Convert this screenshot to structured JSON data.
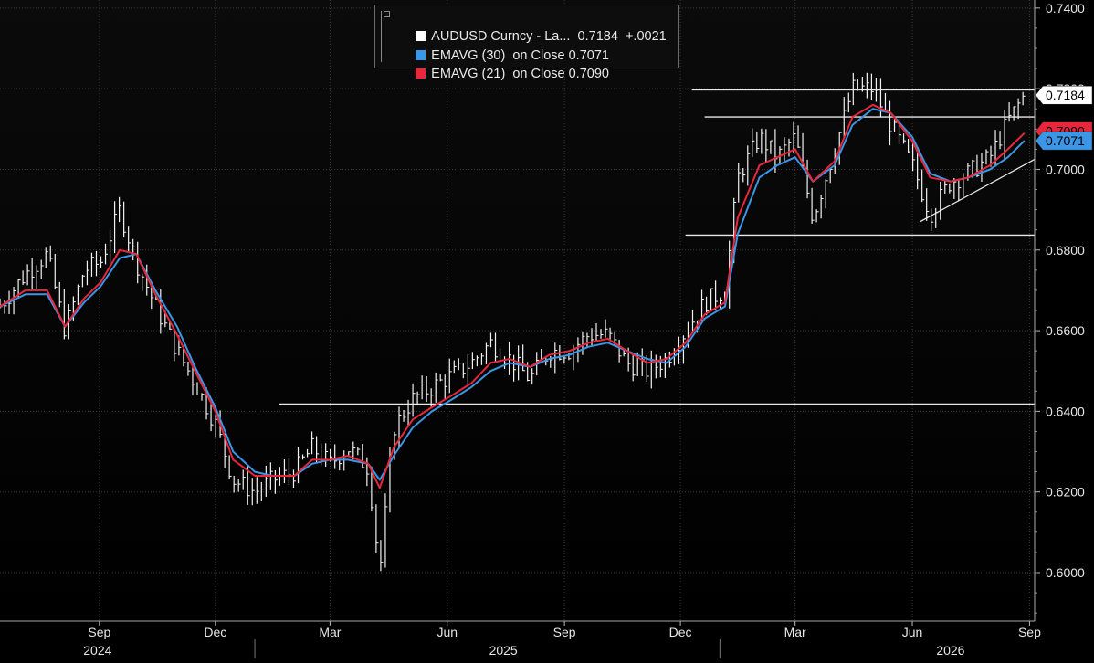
{
  "legend": {
    "rows": [
      {
        "name": "AUDUSD Curncy - La...",
        "value": "0.7184",
        "change": "+.0021",
        "color": "#ffffff"
      },
      {
        "name": "EMAVG (30)",
        "on": "on Close",
        "value": "0.7071",
        "color": "#3c96e6"
      },
      {
        "name": "EMAVG (21)",
        "on": "on Close",
        "value": "0.7090",
        "color": "#e8273a"
      }
    ]
  },
  "axis": {
    "y_ticks": [
      "0.7400",
      "0.7200",
      "0.7000",
      "0.6800",
      "0.6600",
      "0.6400",
      "0.6200",
      "0.6000"
    ],
    "x_months": [
      "Sep",
      "Dec",
      "Mar",
      "Jun",
      "Sep",
      "Dec",
      "Mar",
      "Jun",
      "Sep"
    ],
    "x_years": [
      "2024",
      "2025",
      "2026"
    ]
  },
  "price_tags": {
    "last": {
      "label": "0.7184",
      "value": 0.7184,
      "color": "#ffffff",
      "text_color": "#000000"
    },
    "ema30": {
      "label": "0.7071",
      "value": 0.7071,
      "color": "#3c96e6",
      "text_color": "#000000"
    },
    "ema21": {
      "label": "0.7090",
      "value": 0.709,
      "color": "#e8273a",
      "text_color": "#000000"
    }
  },
  "colors": {
    "background": "#000000",
    "price": "#ffffff",
    "ema30": "#3c96e6",
    "ema21": "#e8273a",
    "grid": "#4a4a4a"
  },
  "chart_data": {
    "type": "line",
    "title": "",
    "xlabel": "",
    "ylabel": "",
    "ylim": [
      0.588,
      0.742
    ],
    "grid": true,
    "legend_placement": "top-center",
    "y_axis_side": "right",
    "x_range": [
      "2024-06-15",
      "2026-09-05"
    ],
    "series": [
      {
        "name": "AUDUSD Curncy - La...",
        "style": "high-low bars",
        "x": [
          "2024-06-15",
          "2024-07-05",
          "2024-07-22",
          "2024-08-05",
          "2024-08-20",
          "2024-09-02",
          "2024-09-17",
          "2024-09-30",
          "2024-10-15",
          "2024-11-01",
          "2024-11-15",
          "2024-12-01",
          "2024-12-15",
          "2025-01-01",
          "2025-01-15",
          "2025-02-01",
          "2025-02-15",
          "2025-03-01",
          "2025-03-15",
          "2025-03-31",
          "2025-04-09",
          "2025-04-20",
          "2025-05-05",
          "2025-05-20",
          "2025-06-05",
          "2025-06-20",
          "2025-07-05",
          "2025-07-20",
          "2025-08-05",
          "2025-08-20",
          "2025-09-05",
          "2025-09-20",
          "2025-10-05",
          "2025-10-20",
          "2025-11-05",
          "2025-11-20",
          "2025-12-05",
          "2025-12-20",
          "2026-01-05",
          "2026-01-15",
          "2026-02-01",
          "2026-02-15",
          "2026-03-01",
          "2026-03-15",
          "2026-04-01",
          "2026-04-15",
          "2026-05-01",
          "2026-05-15",
          "2026-06-01",
          "2026-06-15",
          "2026-07-01",
          "2026-07-15",
          "2026-08-01",
          "2026-08-15",
          "2026-08-28"
        ],
        "values": [
          0.666,
          0.674,
          0.679,
          0.66,
          0.675,
          0.677,
          0.69,
          0.677,
          0.666,
          0.655,
          0.647,
          0.637,
          0.623,
          0.62,
          0.623,
          0.625,
          0.631,
          0.627,
          0.631,
          0.626,
          0.6,
          0.636,
          0.643,
          0.646,
          0.649,
          0.652,
          0.657,
          0.653,
          0.648,
          0.655,
          0.655,
          0.659,
          0.659,
          0.652,
          0.65,
          0.653,
          0.66,
          0.667,
          0.67,
          0.698,
          0.708,
          0.703,
          0.708,
          0.688,
          0.705,
          0.72,
          0.72,
          0.711,
          0.701,
          0.689,
          0.697,
          0.699,
          0.703,
          0.712,
          0.7184
        ]
      },
      {
        "name": "EMAVG (30)",
        "x": [
          "2024-06-15",
          "2024-07-05",
          "2024-07-22",
          "2024-08-05",
          "2024-08-20",
          "2024-09-02",
          "2024-09-17",
          "2024-09-30",
          "2024-10-15",
          "2024-11-01",
          "2024-11-15",
          "2024-12-01",
          "2024-12-15",
          "2025-01-01",
          "2025-01-15",
          "2025-02-01",
          "2025-02-15",
          "2025-03-01",
          "2025-03-15",
          "2025-03-31",
          "2025-04-09",
          "2025-04-20",
          "2025-05-05",
          "2025-05-20",
          "2025-06-05",
          "2025-06-20",
          "2025-07-05",
          "2025-07-20",
          "2025-08-05",
          "2025-08-20",
          "2025-09-05",
          "2025-09-20",
          "2025-10-05",
          "2025-10-20",
          "2025-11-05",
          "2025-11-20",
          "2025-12-05",
          "2025-12-20",
          "2026-01-05",
          "2026-01-15",
          "2026-02-01",
          "2026-02-15",
          "2026-03-01",
          "2026-03-15",
          "2026-04-01",
          "2026-04-15",
          "2026-05-01",
          "2026-05-15",
          "2026-06-01",
          "2026-06-15",
          "2026-07-01",
          "2026-07-15",
          "2026-08-01",
          "2026-08-15",
          "2026-08-28"
        ],
        "values": [
          0.666,
          0.669,
          0.669,
          0.661,
          0.667,
          0.671,
          0.678,
          0.679,
          0.67,
          0.661,
          0.651,
          0.641,
          0.63,
          0.625,
          0.624,
          0.624,
          0.627,
          0.628,
          0.628,
          0.627,
          0.623,
          0.629,
          0.636,
          0.64,
          0.643,
          0.646,
          0.65,
          0.652,
          0.651,
          0.653,
          0.654,
          0.656,
          0.657,
          0.655,
          0.653,
          0.652,
          0.656,
          0.663,
          0.666,
          0.684,
          0.698,
          0.701,
          0.703,
          0.697,
          0.701,
          0.711,
          0.715,
          0.714,
          0.708,
          0.699,
          0.697,
          0.698,
          0.7,
          0.703,
          0.7071
        ]
      },
      {
        "name": "EMAVG (21)",
        "x": [
          "2024-06-15",
          "2024-07-05",
          "2024-07-22",
          "2024-08-05",
          "2024-08-20",
          "2024-09-02",
          "2024-09-17",
          "2024-09-30",
          "2024-10-15",
          "2024-11-01",
          "2024-11-15",
          "2024-12-01",
          "2024-12-15",
          "2025-01-01",
          "2025-01-15",
          "2025-02-01",
          "2025-02-15",
          "2025-03-01",
          "2025-03-15",
          "2025-03-31",
          "2025-04-09",
          "2025-04-20",
          "2025-05-05",
          "2025-05-20",
          "2025-06-05",
          "2025-06-20",
          "2025-07-05",
          "2025-07-20",
          "2025-08-05",
          "2025-08-20",
          "2025-09-05",
          "2025-09-20",
          "2025-10-05",
          "2025-10-20",
          "2025-11-05",
          "2025-11-20",
          "2025-12-05",
          "2025-12-20",
          "2026-01-05",
          "2026-01-15",
          "2026-02-01",
          "2026-02-15",
          "2026-03-01",
          "2026-03-15",
          "2026-04-01",
          "2026-04-15",
          "2026-05-01",
          "2026-05-15",
          "2026-06-01",
          "2026-06-15",
          "2026-07-01",
          "2026-07-15",
          "2026-08-01",
          "2026-08-15",
          "2026-08-28"
        ],
        "values": [
          0.666,
          0.67,
          0.67,
          0.661,
          0.668,
          0.672,
          0.68,
          0.679,
          0.669,
          0.659,
          0.65,
          0.64,
          0.628,
          0.624,
          0.624,
          0.624,
          0.628,
          0.628,
          0.629,
          0.627,
          0.621,
          0.631,
          0.638,
          0.641,
          0.644,
          0.647,
          0.652,
          0.653,
          0.651,
          0.654,
          0.655,
          0.657,
          0.658,
          0.655,
          0.652,
          0.653,
          0.657,
          0.664,
          0.667,
          0.688,
          0.701,
          0.703,
          0.705,
          0.697,
          0.702,
          0.713,
          0.716,
          0.714,
          0.707,
          0.698,
          0.697,
          0.698,
          0.701,
          0.705,
          0.709
        ]
      }
    ],
    "annotations": [
      {
        "type": "horizontal-line",
        "y": 0.7197,
        "x_start": "2025-12-10"
      },
      {
        "type": "horizontal-line",
        "y": 0.713,
        "x_start": "2025-12-20"
      },
      {
        "type": "horizontal-line",
        "y": 0.6837,
        "x_start": "2025-12-05"
      },
      {
        "type": "horizontal-line",
        "y": 0.6418,
        "x_start": "2025-01-20"
      },
      {
        "type": "trendline",
        "from": {
          "x": "2026-06-07",
          "y": 0.687
        },
        "to": {
          "x": "2026-09-05",
          "y": 0.7025
        }
      }
    ]
  }
}
